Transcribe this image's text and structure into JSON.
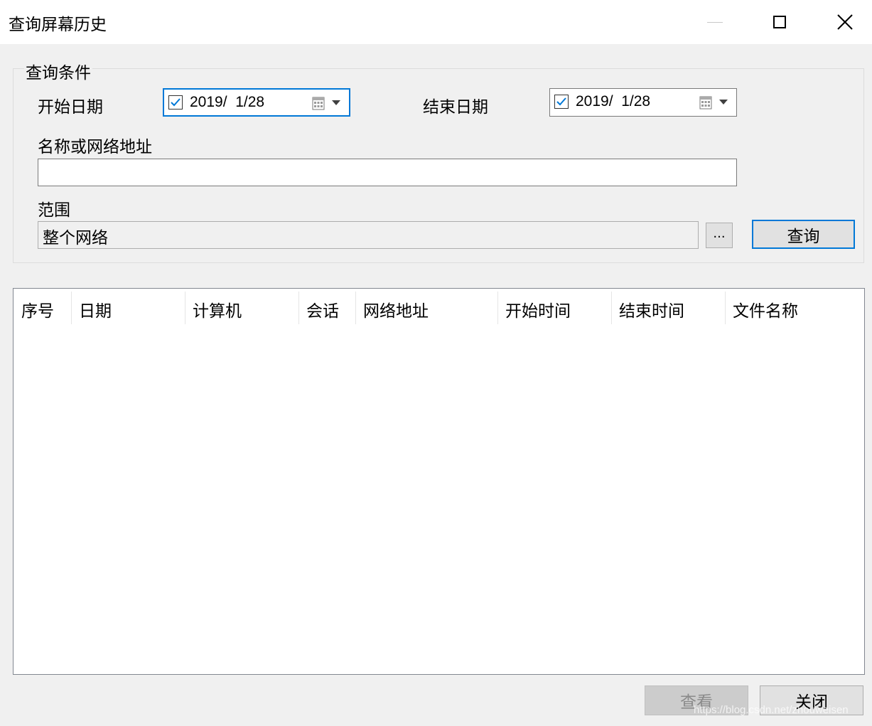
{
  "window": {
    "title": "查询屏幕历史"
  },
  "criteria": {
    "group_title": "查询条件",
    "start_date_label": "开始日期",
    "start_date_value": "2019/  1/28",
    "start_date_checked": true,
    "end_date_label": "结束日期",
    "end_date_value": "2019/  1/28",
    "end_date_checked": true,
    "name_label": "名称或网络地址",
    "name_value": "",
    "scope_label": "范围",
    "scope_value": "整个网络",
    "browse_label": "...",
    "query_label": "查询"
  },
  "table": {
    "columns": [
      "序号",
      "日期",
      "计算机",
      "会话",
      "网络地址",
      "开始时间",
      "结束时间",
      "文件名称"
    ],
    "rows": []
  },
  "footer": {
    "view_label": "查看",
    "close_label": "关闭"
  },
  "watermark": "https://blog.csdn.net/zhouweisen"
}
